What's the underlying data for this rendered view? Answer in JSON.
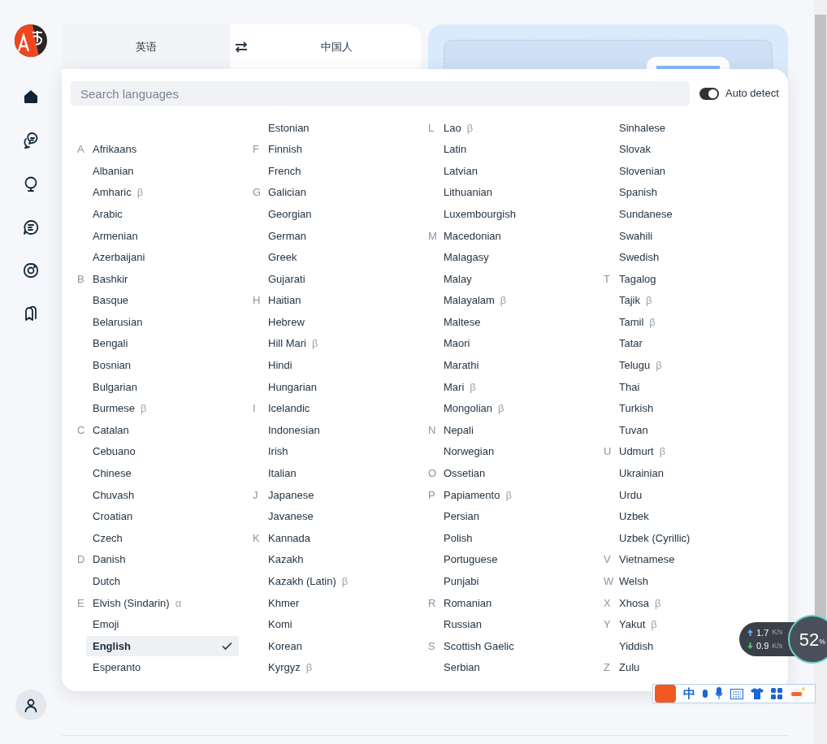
{
  "tabs": [
    {
      "label": "英语",
      "selected": true
    },
    {
      "label": "中国人",
      "selected": false
    }
  ],
  "search": {
    "placeholder": "Search languages"
  },
  "auto_detect": {
    "label": "Auto detect",
    "on": true
  },
  "columns": [
    [
      {
        "name": "Afrikaans",
        "letter": "A",
        "selected": false
      },
      {
        "name": "Albanian",
        "selected": false
      },
      {
        "name": "Amharic",
        "badge": "β",
        "selected": false
      },
      {
        "name": "Arabic",
        "selected": false
      },
      {
        "name": "Armenian",
        "selected": false
      },
      {
        "name": "Azerbaijani",
        "selected": false
      },
      {
        "name": "Bashkir",
        "letter": "B",
        "selected": false
      },
      {
        "name": "Basque",
        "selected": false
      },
      {
        "name": "Belarusian",
        "selected": false
      },
      {
        "name": "Bengali",
        "selected": false
      },
      {
        "name": "Bosnian",
        "selected": false
      },
      {
        "name": "Bulgarian",
        "selected": false
      },
      {
        "name": "Burmese",
        "badge": "β",
        "selected": false
      },
      {
        "name": "Catalan",
        "letter": "C",
        "selected": false
      },
      {
        "name": "Cebuano",
        "selected": false
      },
      {
        "name": "Chinese",
        "selected": false
      },
      {
        "name": "Chuvash",
        "selected": false
      },
      {
        "name": "Croatian",
        "selected": false
      },
      {
        "name": "Czech",
        "selected": false
      },
      {
        "name": "Danish",
        "letter": "D",
        "selected": false
      },
      {
        "name": "Dutch",
        "selected": false
      },
      {
        "name": "Elvish (Sindarin)",
        "letter": "E",
        "badge": "α",
        "selected": false
      },
      {
        "name": "Emoji",
        "selected": false
      },
      {
        "name": "English",
        "selected": true
      },
      {
        "name": "Esperanto",
        "selected": false
      }
    ],
    [
      {
        "name": "Estonian",
        "selected": false
      },
      {
        "name": "Finnish",
        "letter": "F",
        "selected": false
      },
      {
        "name": "French",
        "selected": false
      },
      {
        "name": "Galician",
        "letter": "G",
        "selected": false
      },
      {
        "name": "Georgian",
        "selected": false
      },
      {
        "name": "German",
        "selected": false
      },
      {
        "name": "Greek",
        "selected": false
      },
      {
        "name": "Gujarati",
        "selected": false
      },
      {
        "name": "Haitian",
        "letter": "H",
        "selected": false
      },
      {
        "name": "Hebrew",
        "selected": false
      },
      {
        "name": "Hill Mari",
        "badge": "β",
        "selected": false
      },
      {
        "name": "Hindi",
        "selected": false
      },
      {
        "name": "Hungarian",
        "selected": false
      },
      {
        "name": "Icelandic",
        "letter": "I",
        "selected": false
      },
      {
        "name": "Indonesian",
        "selected": false
      },
      {
        "name": "Irish",
        "selected": false
      },
      {
        "name": "Italian",
        "selected": false
      },
      {
        "name": "Japanese",
        "letter": "J",
        "selected": false
      },
      {
        "name": "Javanese",
        "selected": false
      },
      {
        "name": "Kannada",
        "letter": "K",
        "selected": false
      },
      {
        "name": "Kazakh",
        "selected": false
      },
      {
        "name": "Kazakh (Latin)",
        "badge": "β",
        "selected": false
      },
      {
        "name": "Khmer",
        "selected": false
      },
      {
        "name": "Komi",
        "selected": false
      },
      {
        "name": "Korean",
        "selected": false
      },
      {
        "name": "Kyrgyz",
        "badge": "β",
        "selected": false
      }
    ],
    [
      {
        "name": "Lao",
        "letter": "L",
        "badge": "β",
        "selected": false
      },
      {
        "name": "Latin",
        "selected": false
      },
      {
        "name": "Latvian",
        "selected": false
      },
      {
        "name": "Lithuanian",
        "selected": false
      },
      {
        "name": "Luxembourgish",
        "selected": false
      },
      {
        "name": "Macedonian",
        "letter": "M",
        "selected": false
      },
      {
        "name": "Malagasy",
        "selected": false
      },
      {
        "name": "Malay",
        "selected": false
      },
      {
        "name": "Malayalam",
        "badge": "β",
        "selected": false
      },
      {
        "name": "Maltese",
        "selected": false
      },
      {
        "name": "Maori",
        "selected": false
      },
      {
        "name": "Marathi",
        "selected": false
      },
      {
        "name": "Mari",
        "badge": "β",
        "selected": false
      },
      {
        "name": "Mongolian",
        "badge": "β",
        "selected": false
      },
      {
        "name": "Nepali",
        "letter": "N",
        "selected": false
      },
      {
        "name": "Norwegian",
        "selected": false
      },
      {
        "name": "Ossetian",
        "letter": "O",
        "selected": false
      },
      {
        "name": "Papiamento",
        "letter": "P",
        "badge": "β",
        "selected": false
      },
      {
        "name": "Persian",
        "selected": false
      },
      {
        "name": "Polish",
        "selected": false
      },
      {
        "name": "Portuguese",
        "selected": false
      },
      {
        "name": "Punjabi",
        "selected": false
      },
      {
        "name": "Romanian",
        "letter": "R",
        "selected": false
      },
      {
        "name": "Russian",
        "selected": false
      },
      {
        "name": "Scottish Gaelic",
        "letter": "S",
        "selected": false
      },
      {
        "name": "Serbian",
        "selected": false
      }
    ],
    [
      {
        "name": "Sinhalese",
        "selected": false
      },
      {
        "name": "Slovak",
        "selected": false
      },
      {
        "name": "Slovenian",
        "selected": false
      },
      {
        "name": "Spanish",
        "selected": false
      },
      {
        "name": "Sundanese",
        "selected": false
      },
      {
        "name": "Swahili",
        "selected": false
      },
      {
        "name": "Swedish",
        "selected": false
      },
      {
        "name": "Tagalog",
        "letter": "T",
        "selected": false
      },
      {
        "name": "Tajik",
        "badge": "β",
        "selected": false
      },
      {
        "name": "Tamil",
        "badge": "β",
        "selected": false
      },
      {
        "name": "Tatar",
        "selected": false
      },
      {
        "name": "Telugu",
        "badge": "β",
        "selected": false
      },
      {
        "name": "Thai",
        "selected": false
      },
      {
        "name": "Turkish",
        "selected": false
      },
      {
        "name": "Tuvan",
        "selected": false
      },
      {
        "name": "Udmurt",
        "letter": "U",
        "badge": "β",
        "selected": false
      },
      {
        "name": "Ukrainian",
        "selected": false
      },
      {
        "name": "Urdu",
        "selected": false
      },
      {
        "name": "Uzbek",
        "selected": false
      },
      {
        "name": "Uzbek (Cyrillic)",
        "selected": false
      },
      {
        "name": "Vietnamese",
        "letter": "V",
        "selected": false
      },
      {
        "name": "Welsh",
        "letter": "W",
        "selected": false
      },
      {
        "name": "Xhosa",
        "letter": "X",
        "badge": "β",
        "selected": false
      },
      {
        "name": "Yakut",
        "letter": "Y",
        "badge": "β",
        "selected": false
      },
      {
        "name": "Yiddish",
        "selected": false
      },
      {
        "name": "Zulu",
        "letter": "Z",
        "selected": false
      }
    ]
  ],
  "network_widget": {
    "upload": {
      "value": "1.7",
      "unit": "K/s"
    },
    "download": {
      "value": "0.9",
      "unit": "K/s"
    },
    "percent": {
      "value": "52",
      "unit": "%"
    }
  },
  "ime_toolbar": {
    "mode": "中"
  }
}
